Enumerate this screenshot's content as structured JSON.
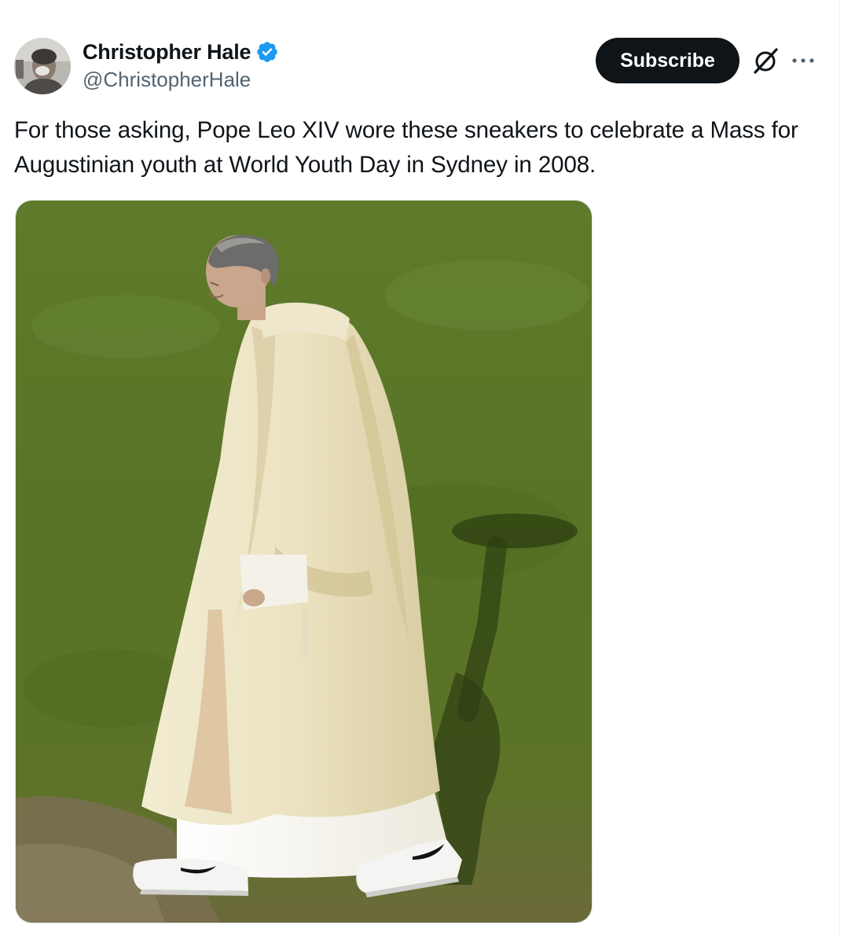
{
  "tweet": {
    "author": {
      "display_name": "Christopher Hale",
      "handle": "@ChristopherHale",
      "verified": true
    },
    "actions": {
      "subscribe_label": "Subscribe"
    },
    "text": "For those asking, Pope Leo XIV wore these sneakers to celebrate a Mass for Augustinian youth at World Youth Day in Sydney in 2008.",
    "icons": {
      "verified": "verified-badge-icon",
      "grok": "grok-icon",
      "more": "more-icon"
    }
  },
  "colors": {
    "text_primary": "#0f1419",
    "text_secondary": "#536471",
    "verified_blue": "#1d9bf0",
    "button_dark": "#0f1419"
  }
}
